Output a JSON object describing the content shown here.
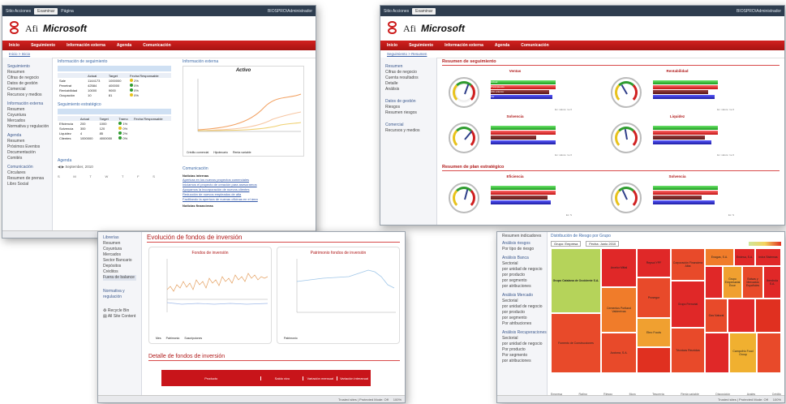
{
  "brand": {
    "afi": "Afi",
    "ms": "Microsoft"
  },
  "nav": [
    "Inicio",
    "Seguimiento",
    "Información externa",
    "Agenda",
    "Comunicación"
  ],
  "win1": {
    "topbar_left": [
      "Sitio Acciones",
      "Examinar",
      "Página"
    ],
    "topbar_right": "BIOSPRO\\Administrador",
    "crumb": "Inicio > Inicio",
    "sidebar": [
      "Seguimiento",
      "Resumen",
      "Cifras de negocio",
      "Datos de gestión",
      "Comercial",
      "Recursos y medios",
      "Información externa",
      "Resumen",
      "Coyuntura",
      "Mercados",
      "Normativa y regulación",
      "Agenda",
      "Resumen",
      "Próximos Eventos",
      "Documentación",
      "Comités",
      "Comunicación",
      "Circulares",
      "Resumen de prensa",
      "Libro Social"
    ],
    "seg_title": "Información de seguimiento",
    "seg_headers": [
      "",
      "Actual",
      "Target",
      "Fecha Responsable"
    ],
    "seg_rows": [
      [
        "Sale",
        "1144173",
        "1000000",
        "2%"
      ],
      [
        "Penetrat",
        "42584",
        "400000",
        "0%"
      ],
      [
        "Rentabilidad",
        "10000",
        "9000",
        "0%"
      ],
      [
        "Ocupación",
        "10",
        "81",
        "0%"
      ]
    ],
    "est_title": "Seguimiento estratégico",
    "est_headers": [
      "",
      "Actual",
      "Target",
      "Tramo",
      "Fecha Responsable"
    ],
    "est_rows": [
      [
        "Eficiencia",
        "200",
        "1000",
        "1%"
      ],
      [
        "Solvencia",
        "300",
        "120",
        "0%"
      ],
      [
        "Liquidez",
        "4",
        "85",
        "2%"
      ],
      [
        "Clientes",
        "1000000",
        "4000000",
        "0%"
      ]
    ],
    "ext_title": "Información externa",
    "chart_title": "Activo",
    "chart_legend": [
      "Crédito comercial",
      "Hipotecario",
      "Renta variable"
    ],
    "com_title": "Comunicación",
    "com_head1": "Noticias internas",
    "com_links": [
      "Apertura en los nuevos proyectos comerciales",
      "Iniciamos el proyecto de creación para asesorarnos",
      "Apoyamos la incorporación de nuevos clientes",
      "Reducción de nuevos empleados de alta",
      "Facilitando la apertura de nuevas oficinas en el área"
    ],
    "com_head2": "Noticias financieras",
    "agenda_title": "Agenda",
    "agenda_month": "September, 2010",
    "cal_days": [
      "S",
      "M",
      "T",
      "W",
      "T",
      "F",
      "S"
    ],
    "status_mid": "Intranet Zone (Mixed) | Protected Mode: Off",
    "status_zoom": "100%"
  },
  "win2": {
    "topbar_left": [
      "Sitio Acciones",
      "Examinar"
    ],
    "topbar_right": "BIOSPRO\\Administrador",
    "crumb": "Seguimiento > Resumen",
    "sidebar": [
      "Resumen",
      "Cifras de negocio",
      "Cuenta resultados",
      "Detalle",
      "Análisis",
      "Datos de gestión",
      "Riesgos",
      "Resumen riesgos",
      "Comercial",
      "Recursos y medios"
    ],
    "sec1": "Resumen de seguimiento",
    "gauges": [
      {
        "title": "Ventas",
        "note": "Ex: valore: 1e 0"
      },
      {
        "title": "Rentabilidad",
        "note": "Ex: valore: 1e 0"
      },
      {
        "title": "Solvencia",
        "note": "Ex: valore: 1e 0"
      },
      {
        "title": "Liquidez",
        "note": "Ex: valore: 1e 0"
      }
    ],
    "sec2": "Resumen de plan estratégico",
    "gauges2": [
      {
        "title": "Eficiencia",
        "note": "Ex: S"
      },
      {
        "title": "Solvencia",
        "note": "Ex: S"
      }
    ],
    "bar_labels": [
      "Actual",
      "Presupuesto",
      "Año anterior",
      "Var"
    ]
  },
  "win3": {
    "sidebar": [
      "Librerías",
      "Resumen",
      "Coyuntura",
      "Mercados",
      "Sector Bancario",
      "Depósitos",
      "Créditos",
      "Fuera de balance",
      "Normativa y regulación",
      "Recycle Bin",
      "All Site Content"
    ],
    "title": "Evolución de fondos de inversión",
    "chart1_title": "Fondos de inversión",
    "chart1_legend": [
      "Mes",
      "Patrimonio",
      "Suscripciones"
    ],
    "chart2_title": "Patrimonio fondos de inversión",
    "chart2_legend": [
      "Patrimonio"
    ],
    "det_title": "Detalle de fondos de inversión",
    "table_headers": [
      "Producto",
      "Saldo vivo",
      "Variación mensual",
      "Variación interanual"
    ],
    "status_mid": "Trusted sites | Protected Mode: Off",
    "status_zoom": "100%"
  },
  "win4": {
    "sidebar_top": "Resumen indicadores",
    "sidebar": [
      "Análisis riesgos",
      "Por tipo de riesgo",
      "Análisis Banca",
      "Sectorial",
      "por unidad de negocio",
      "por producto",
      "por segmento",
      "por atribuciones",
      "Análisis Mercado",
      "Sectorial",
      "por unidad de negocio",
      "por producto",
      "por segmento",
      "Por atribuciones",
      "Análisis Recuperaciones",
      "Sectorial",
      "por unidad de negocio",
      "Por producto",
      "Por segmento",
      "por atribuciones"
    ],
    "title": "Distribución de Riesgo por Grupo",
    "filter1": "Grupo: Empresa",
    "filter2": "Fecha: Junio 2010",
    "cells": [
      "Grupo Catalana de Occidente S.A.",
      "Arcelor Mittal",
      "Repsol YPF",
      "Corporación Financiera Alba",
      "Enagas, S.A.",
      "Endesa, S.A.",
      "Indra Sistemas",
      "Iberdrola S.A.",
      "Grupo Empresarial Ence",
      "Bolsas y Mercados Españoles",
      "Gas Natural",
      "Cementos Portland Valderrivas",
      "Fomento de Construcciones",
      "Acciona, S.A.",
      "Prosegur",
      "Ebro Foods",
      "Grupo Ferrovial",
      "Técnicas Reunidas",
      "Campofrío Food Group"
    ],
    "xaxis": [
      "Empresa",
      "Rating",
      "Riesgo",
      "Mora",
      "Tesorería",
      "Renta variable",
      "Disposición",
      "Avales",
      "Crédito"
    ],
    "status_mid": "Trusted sites | Protected Mode: Off",
    "status_zoom": "100%"
  }
}
